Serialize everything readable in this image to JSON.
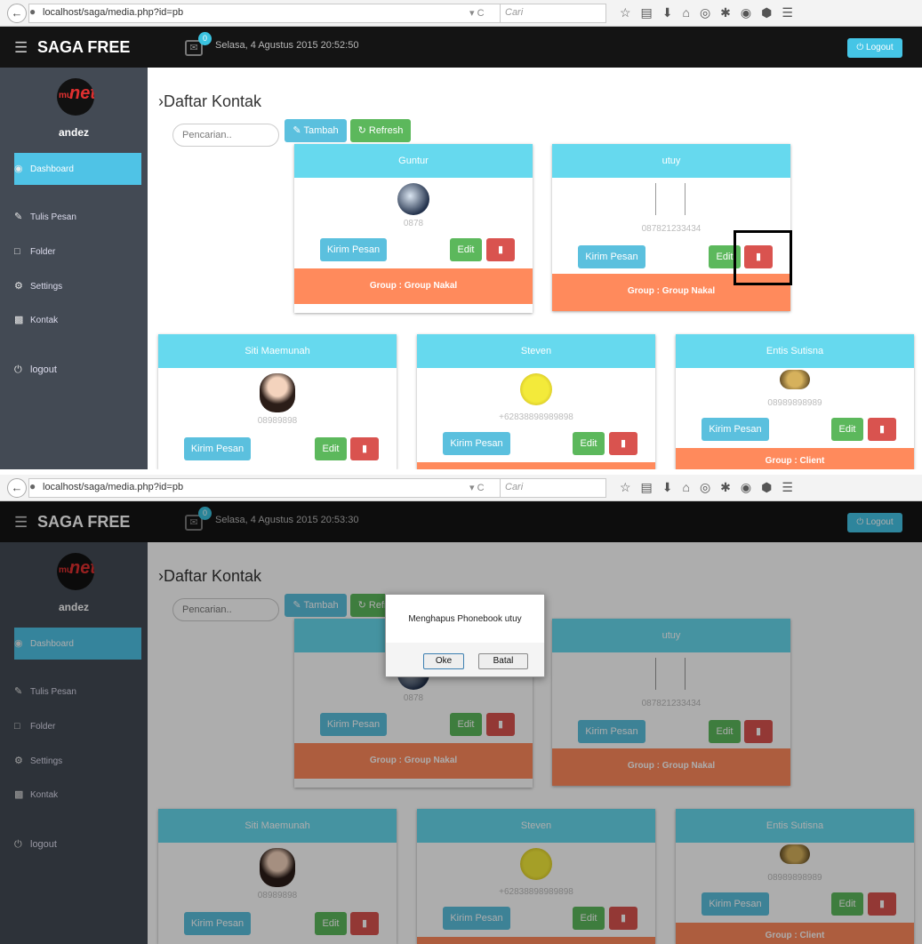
{
  "browser": {
    "url": "localhost/saga/media.php?id=pb",
    "search_placeholder": "Cari"
  },
  "app": {
    "brand": "SAGA FREE",
    "mail_badge": "0",
    "logout_label": "Logout"
  },
  "frames": [
    {
      "datetime": "Selasa, 4 Agustus 2015 20:52:50"
    },
    {
      "datetime": "Selasa, 4 Agustus 2015 20:53:30"
    }
  ],
  "sidebar": {
    "username": "andez",
    "items": [
      {
        "label": "Dashboard"
      },
      {
        "label": "Tulis Pesan"
      },
      {
        "label": "Folder"
      },
      {
        "label": "Settings"
      },
      {
        "label": "Kontak"
      },
      {
        "label": "logout"
      }
    ]
  },
  "content": {
    "title": "›Daftar Kontak",
    "search_placeholder": "Pencarian..",
    "add_label": "Tambah",
    "refresh_label": "Refresh"
  },
  "contacts": [
    {
      "name": "Guntur",
      "phone": "0878",
      "group": "Group : Group Nakal"
    },
    {
      "name": "utuy",
      "phone": "087821233434",
      "group": "Group : Group Nakal"
    },
    {
      "name": "Siti Maemunah",
      "phone": "08989898",
      "group": ""
    },
    {
      "name": "Steven",
      "phone": "+62838898989898",
      "group": ""
    },
    {
      "name": "Entis Sutisna",
      "phone": "08989898989",
      "group": "Group : Client"
    }
  ],
  "card_labels": {
    "send": "Kirim Pesan",
    "edit": "Edit"
  },
  "dialog": {
    "message": "Menghapus Phonebook utuy",
    "ok_label": "Oke",
    "cancel_label": "Batal"
  },
  "colors": {
    "header": "#141414",
    "sidebar": "#434a54",
    "accent": "#66d9ee",
    "success": "#5cb85c",
    "danger": "#d9534f",
    "group": "#ff8a5c"
  }
}
